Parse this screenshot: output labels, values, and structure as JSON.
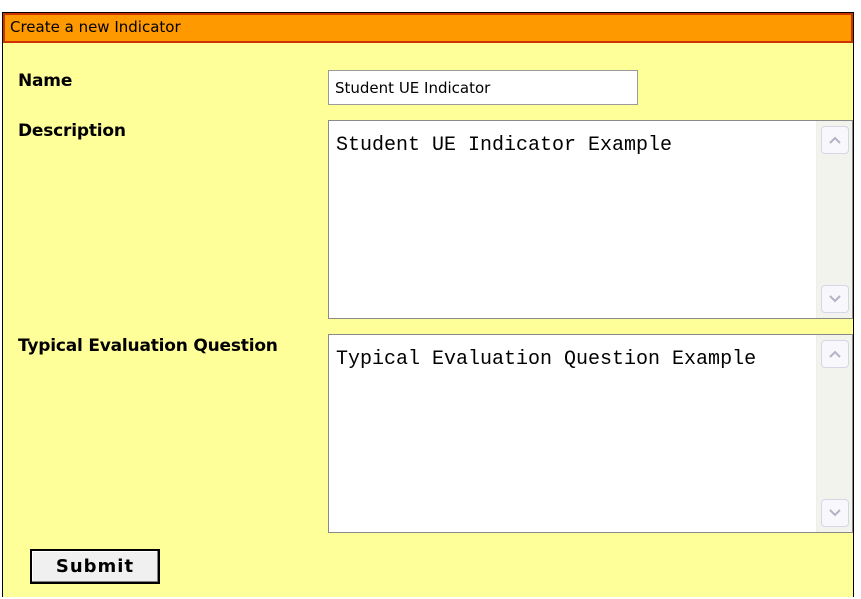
{
  "form": {
    "title": "Create a new Indicator",
    "name_label": "Name",
    "name_value": "Student UE Indicator",
    "description_label": "Description",
    "description_value": "Student UE Indicator Example",
    "question_label": "Typical Evaluation Question",
    "question_value": "Typical Evaluation Question Example",
    "submit_label": "Submit"
  },
  "colors": {
    "panel_background": "#ffff99",
    "title_bar": "#ff9900",
    "title_border": "#cc3300"
  },
  "icons": {
    "scroll_up": "chevron-up-icon",
    "scroll_down": "chevron-down-icon"
  }
}
